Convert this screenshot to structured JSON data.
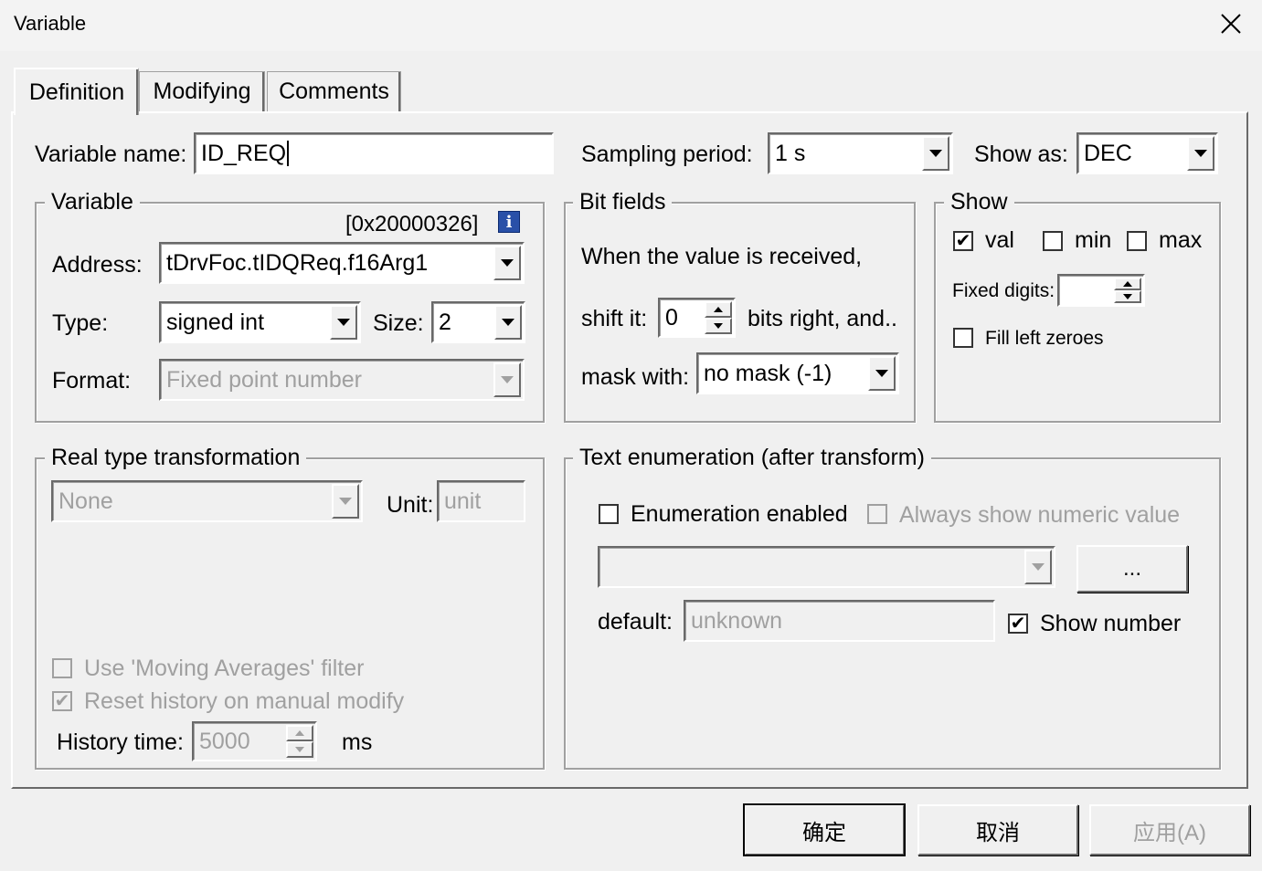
{
  "window": {
    "title": "Variable"
  },
  "tabs": [
    {
      "label": "Definition",
      "active": true
    },
    {
      "label": "Modifying",
      "active": false
    },
    {
      "label": "Comments",
      "active": false
    }
  ],
  "top": {
    "variable_name_label": "Variable name:",
    "variable_name_value": "ID_REQ",
    "sampling_period_label": "Sampling period:",
    "sampling_period_value": "1 s",
    "show_as_label": "Show as:",
    "show_as_value": "DEC"
  },
  "variable_group": {
    "title": "Variable",
    "address_hex": "[0x20000326]",
    "address_label": "Address:",
    "address_value": "tDrvFoc.tIDQReq.f16Arg1",
    "type_label": "Type:",
    "type_value": "signed int",
    "size_label": "Size:",
    "size_value": "2",
    "format_label": "Format:",
    "format_value": "Fixed point number"
  },
  "bit_fields": {
    "title": "Bit fields",
    "intro": "When the value is received,",
    "shift_label": "shift it:",
    "shift_value": "0",
    "shift_suffix": "bits right, and..",
    "mask_label": "mask with:",
    "mask_value": "no mask (-1)"
  },
  "show_group": {
    "title": "Show",
    "val_label": "val",
    "val_checked": true,
    "min_label": "min",
    "min_checked": false,
    "max_label": "max",
    "max_checked": false,
    "fixed_digits_label": "Fixed digits:",
    "fixed_digits_value": "",
    "fill_zeroes_label": "Fill left zeroes",
    "fill_zeroes_checked": false
  },
  "real_type": {
    "title": "Real type transformation",
    "transform_value": "None",
    "unit_label": "Unit:",
    "unit_value": "unit",
    "moving_avg_label": "Use 'Moving Averages' filter",
    "moving_avg_checked": false,
    "reset_history_label": "Reset history on manual modify",
    "reset_history_checked": true,
    "history_time_label": "History time:",
    "history_time_value": "5000",
    "history_time_unit": "ms"
  },
  "text_enum": {
    "title": "Text enumeration (after transform)",
    "enabled_label": "Enumeration enabled",
    "enabled_checked": false,
    "always_numeric_label": "Always show numeric value",
    "always_numeric_checked": false,
    "enum_value": "",
    "ellipsis_label": "...",
    "default_label": "default:",
    "default_value": "unknown",
    "show_number_label": "Show number",
    "show_number_checked": true
  },
  "buttons": {
    "ok": "确定",
    "cancel": "取消",
    "apply": "应用(A)"
  },
  "icons": {
    "close": "close-icon",
    "info": "info-icon",
    "dropdown": "chevron-down-icon"
  }
}
